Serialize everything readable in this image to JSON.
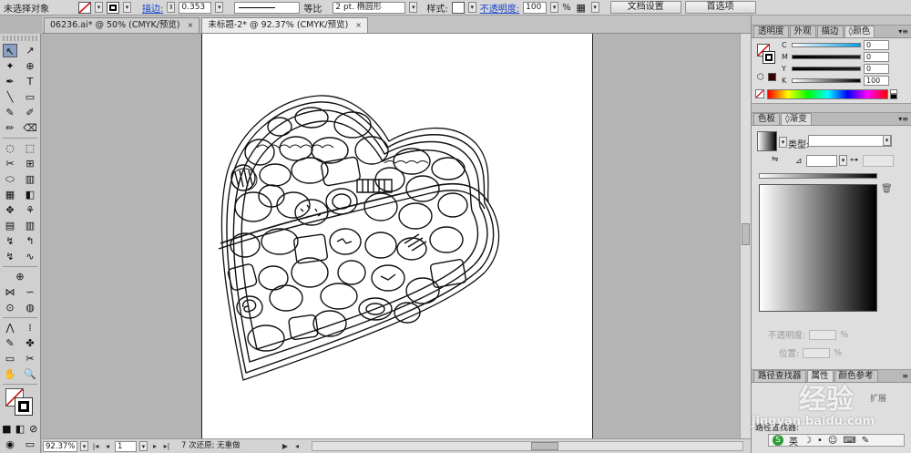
{
  "control": {
    "selection_state": "未选择对象",
    "stroke_label": "描边:",
    "stroke_value": "0.353",
    "profile_label": "等比",
    "brush_label": "2 pt. 椭圆形",
    "style_label": "样式:",
    "opacity_label": "不透明度:",
    "opacity_value": "100",
    "percent": "%",
    "doc_setup_btn": "文档设置",
    "prefs_btn": "首选项"
  },
  "tabs": [
    {
      "label": "06236.ai* @ 50% (CMYK/预览)",
      "close": "×"
    },
    {
      "label": "未标题-2* @ 92.37% (CMYK/预览)",
      "close": "×"
    }
  ],
  "tools": {
    "rows": [
      [
        "↖",
        "↗"
      ],
      [
        "✦",
        "⊕"
      ],
      [
        "✒",
        "T"
      ],
      [
        "╲",
        "▭"
      ],
      [
        "✎",
        "✐"
      ],
      [
        "✏",
        "⌫"
      ],
      [
        "◌",
        "⬚"
      ],
      [
        "✂",
        "⊞"
      ],
      [
        "⬭",
        "▥"
      ],
      [
        "▦",
        "◧"
      ],
      [
        "✥",
        "⚘"
      ],
      [
        "▤",
        "▥"
      ],
      [
        "↯",
        "↰"
      ],
      [
        "↯",
        "∿"
      ],
      [
        "⊕"
      ],
      [
        "⋈",
        "∽"
      ],
      [
        "⊙",
        "◍"
      ],
      [
        "⋀",
        "⁞"
      ],
      [
        "✎",
        "✤"
      ],
      [
        "▭",
        "✂"
      ],
      [
        "✋",
        "🔍"
      ]
    ]
  },
  "status": {
    "zoom": "92.37%",
    "artboard_no": "1",
    "message": "7 次还原; 无重做"
  },
  "panel_color": {
    "tabs": [
      "透明度",
      "外观",
      "描边",
      "颜色"
    ],
    "active": "颜色",
    "channels": [
      {
        "label": "C",
        "value": "0"
      },
      {
        "label": "M",
        "value": "0"
      },
      {
        "label": "Y",
        "value": "0"
      },
      {
        "label": "K",
        "value": "100"
      }
    ]
  },
  "panel_gradient": {
    "tabs": [
      "色板",
      "渐变"
    ],
    "active": "渐变",
    "type_label": "类型:",
    "opacity_label": "不透明度:",
    "position_label": "位置:",
    "percent": "%"
  },
  "panel_bottom": {
    "tabs": [
      "路径查找器",
      "属性",
      "颜色参考"
    ],
    "active": "属性",
    "expand_label": "扩展",
    "pathfinder_label": "路径查找器:"
  },
  "watermark": {
    "brand": "经验",
    "url": "jingyan.baidu.com"
  },
  "ime": {
    "label": "英"
  },
  "colors": {
    "accent": "#1a44c8",
    "artboard": "#ffffff",
    "pasteboard": "#b4b4b4"
  }
}
